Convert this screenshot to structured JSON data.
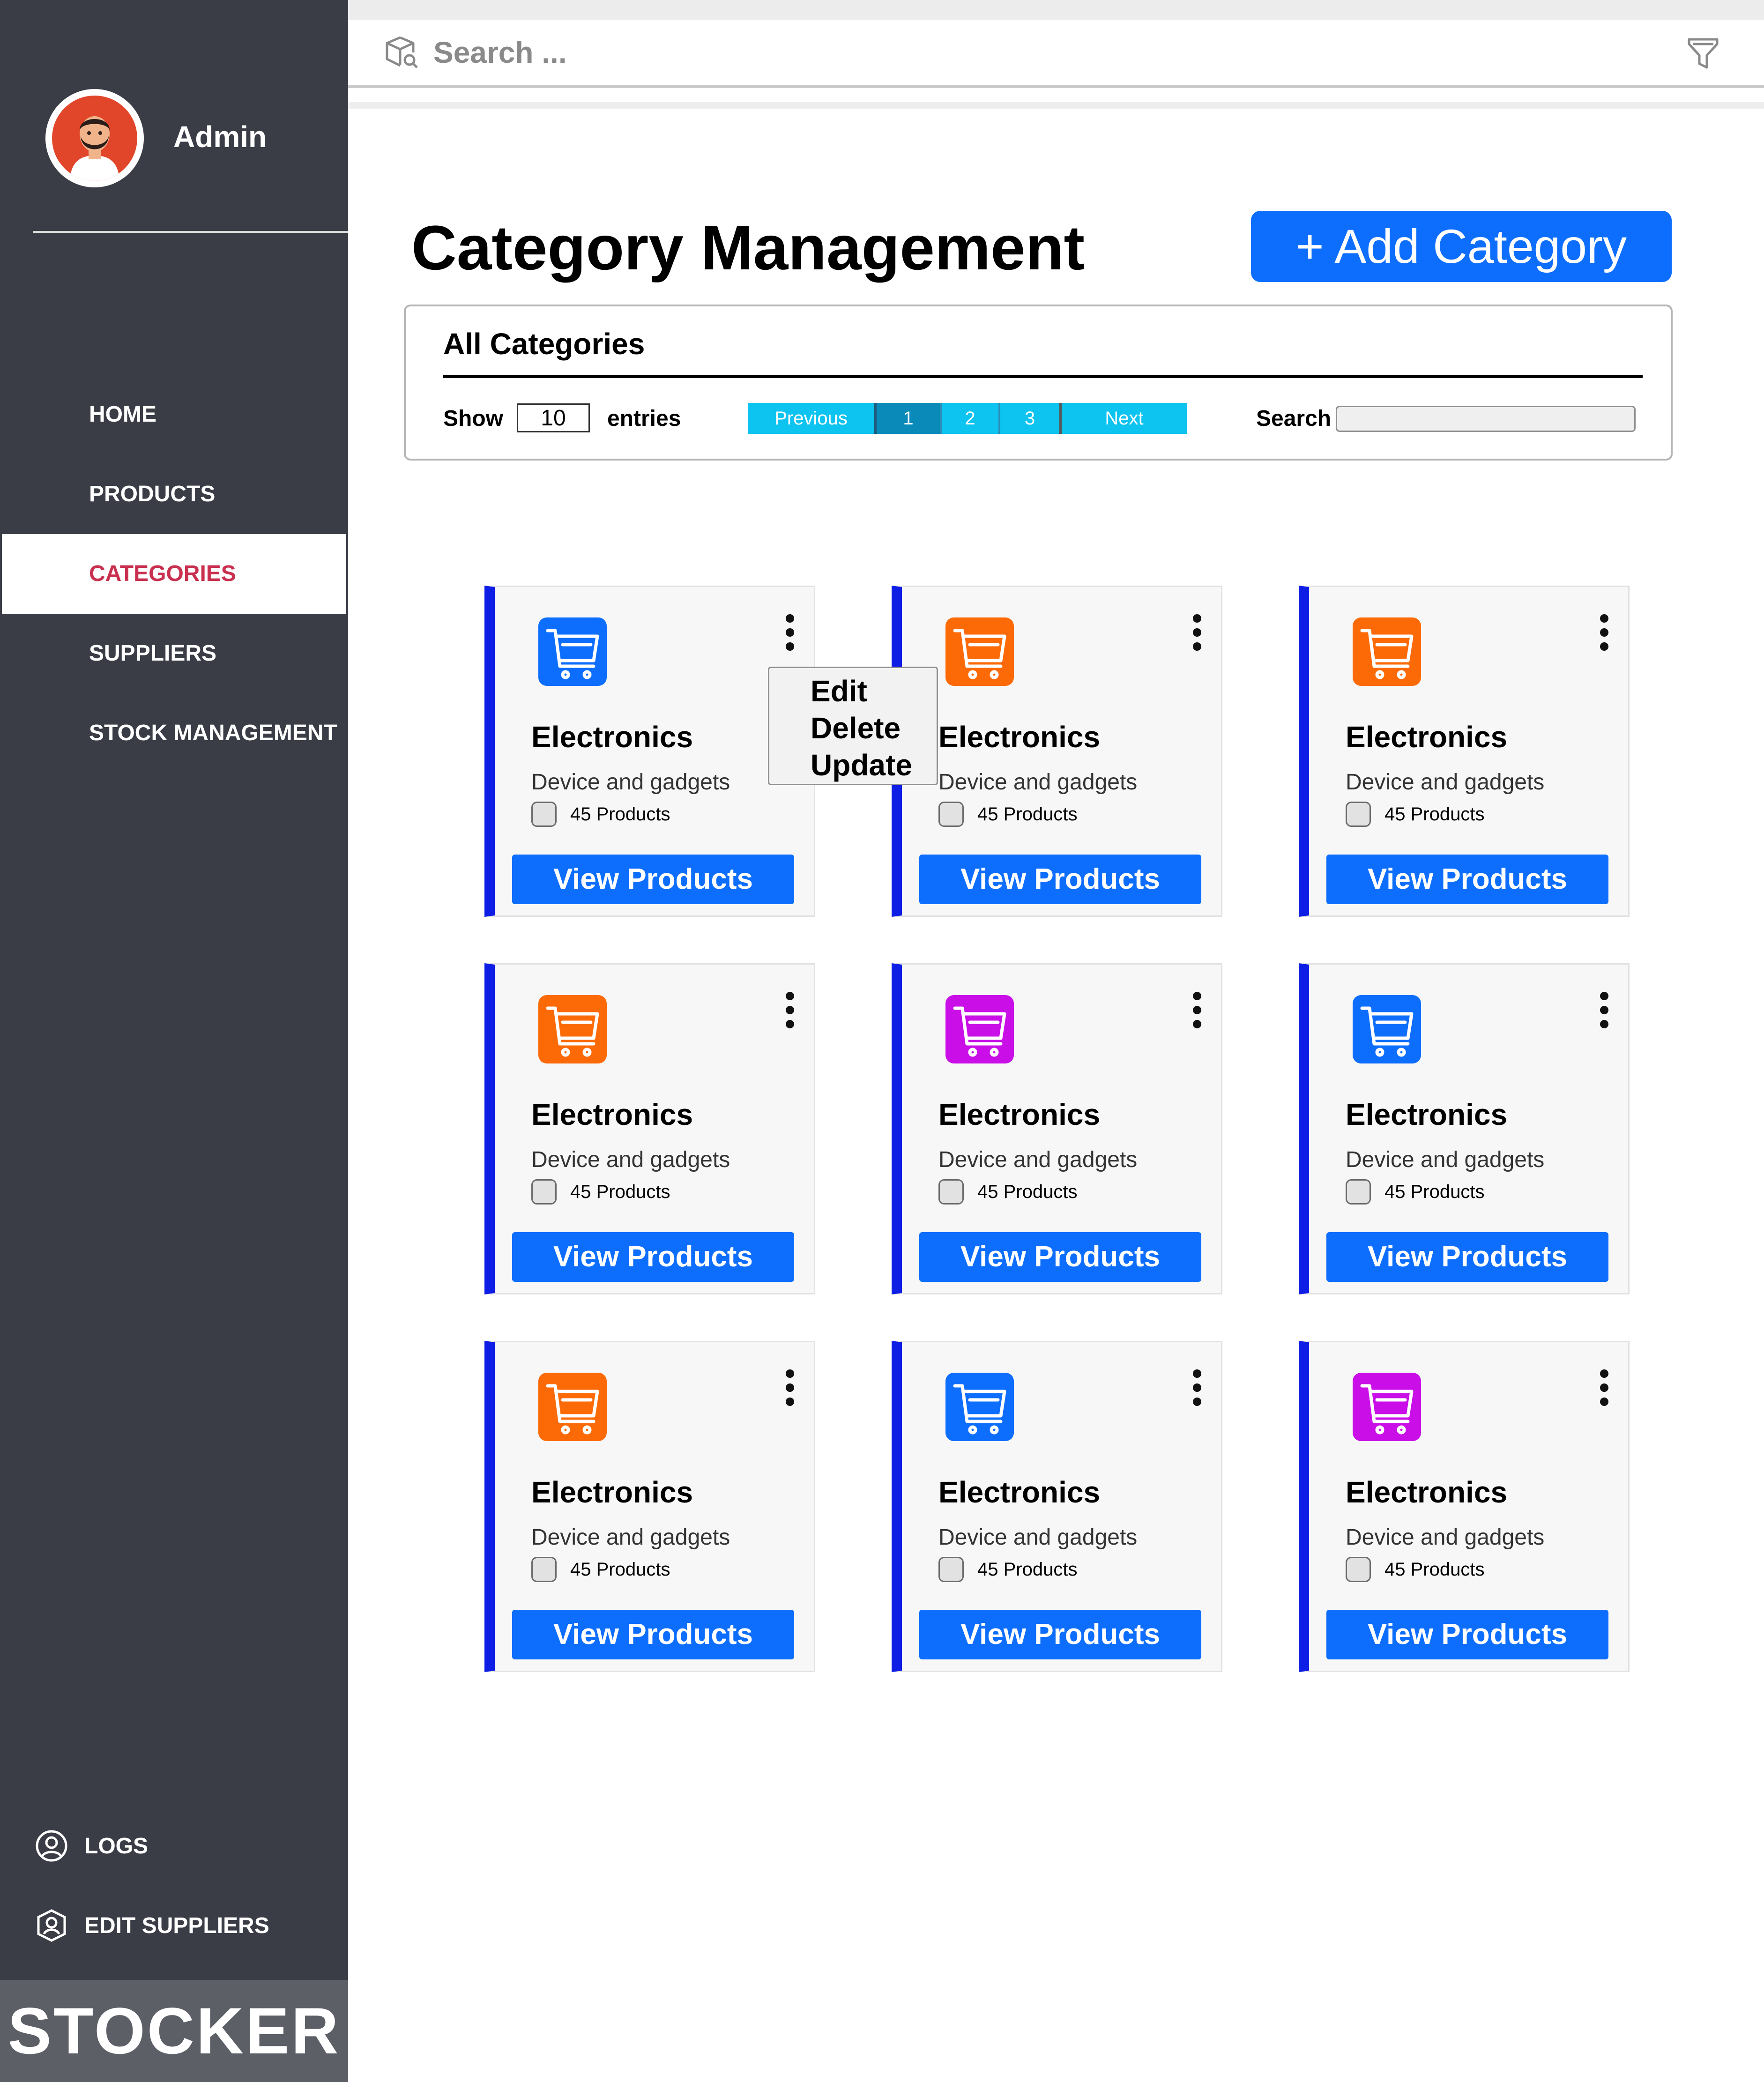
{
  "brand": "STOCKER",
  "user": {
    "name": "Admin"
  },
  "sidebar": {
    "items": [
      {
        "label": "HOME"
      },
      {
        "label": "PRODUCTS"
      },
      {
        "label": "CATEGORIES"
      },
      {
        "label": "SUPPLIERS"
      },
      {
        "label": "STOCK MANAGEMENT"
      }
    ],
    "bottom": [
      {
        "label": "LOGS",
        "icon": "user-circle-icon"
      },
      {
        "label": "EDIT SUPPLIERS",
        "icon": "user-shield-icon"
      }
    ]
  },
  "search": {
    "placeholder": "Search ..."
  },
  "page": {
    "title": "Category Management",
    "add_button": "+ Add Category"
  },
  "table": {
    "title": "All Categories",
    "show_label": "Show",
    "entries_value": "10",
    "entries_label": "entries",
    "search_label": "Search",
    "pagination": {
      "previous": "Previous",
      "pages": [
        "1",
        "2",
        "3"
      ],
      "next": "Next",
      "current": "1"
    }
  },
  "context_menu": {
    "items": [
      "Edit",
      "Delete",
      "Update"
    ]
  },
  "colors": {
    "blue": "#0d6efd",
    "orange": "#fc6a08",
    "purple": "#c90ee8",
    "accent_bar": "#0f1ee5",
    "active_nav_text": "#c9304f"
  },
  "cards": [
    {
      "title": "Electronics",
      "description": "Device and gadgets",
      "count": "45 Products",
      "button": "View Products",
      "icon_color": "#0d6efd"
    },
    {
      "title": "Electronics",
      "description": "Device and gadgets",
      "count": "45 Products",
      "button": "View Products",
      "icon_color": "#fc6a08"
    },
    {
      "title": "Electronics",
      "description": "Device and gadgets",
      "count": "45 Products",
      "button": "View Products",
      "icon_color": "#fc6a08"
    },
    {
      "title": "Electronics",
      "description": "Device and gadgets",
      "count": "45 Products",
      "button": "View Products",
      "icon_color": "#fc6a08"
    },
    {
      "title": "Electronics",
      "description": "Device and gadgets",
      "count": "45 Products",
      "button": "View Products",
      "icon_color": "#c90ee8"
    },
    {
      "title": "Electronics",
      "description": "Device and gadgets",
      "count": "45 Products",
      "button": "View Products",
      "icon_color": "#0d6efd"
    },
    {
      "title": "Electronics",
      "description": "Device and gadgets",
      "count": "45 Products",
      "button": "View Products",
      "icon_color": "#fc6a08"
    },
    {
      "title": "Electronics",
      "description": "Device and gadgets",
      "count": "45 Products",
      "button": "View Products",
      "icon_color": "#0d6efd"
    },
    {
      "title": "Electronics",
      "description": "Device and gadgets",
      "count": "45 Products",
      "button": "View Products",
      "icon_color": "#c90ee8"
    }
  ]
}
